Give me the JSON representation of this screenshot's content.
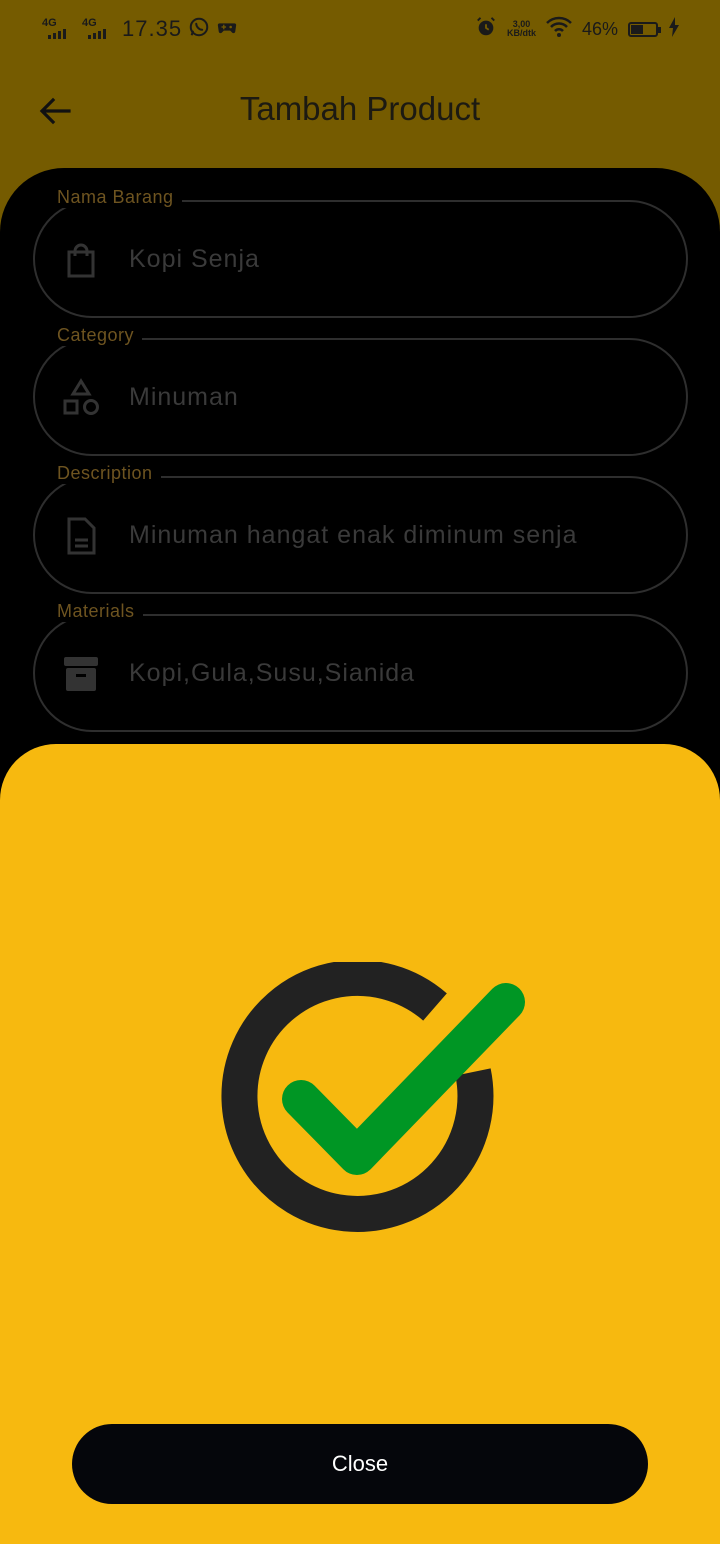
{
  "status_bar": {
    "network_1": "4G",
    "network_2": "4G",
    "time": "17.35",
    "speed_value": "3,00",
    "speed_unit": "KB/dtk",
    "battery_percent": "46%",
    "battery_level": 0.46,
    "icons": [
      "whatsapp-icon",
      "game-controller-icon",
      "alarm-icon",
      "wifi-icon",
      "battery-icon",
      "charging-icon"
    ]
  },
  "app_bar": {
    "title": "Tambah Product",
    "back_icon": "arrow-left-icon"
  },
  "form": {
    "fields": [
      {
        "label": "Nama Barang",
        "value": "Kopi Senja",
        "icon": "shopping-bag-icon"
      },
      {
        "label": "Category",
        "value": "Minuman",
        "icon": "category-shapes-icon"
      },
      {
        "label": "Description",
        "value": "Minuman hangat enak diminum senja",
        "icon": "document-icon"
      },
      {
        "label": "Materials",
        "value": "Kopi,Gula,Susu,Sianida",
        "icon": "archive-box-icon"
      }
    ]
  },
  "success_sheet": {
    "icon": "success-check-icon",
    "close_label": "Close"
  },
  "colors": {
    "app_bar_bg": "#755b00",
    "sheet_bg": "#f7b90f",
    "check_green": "#009624",
    "ring_dark": "#222222",
    "button_bg": "#05060b",
    "label_color": "#6e5420"
  }
}
